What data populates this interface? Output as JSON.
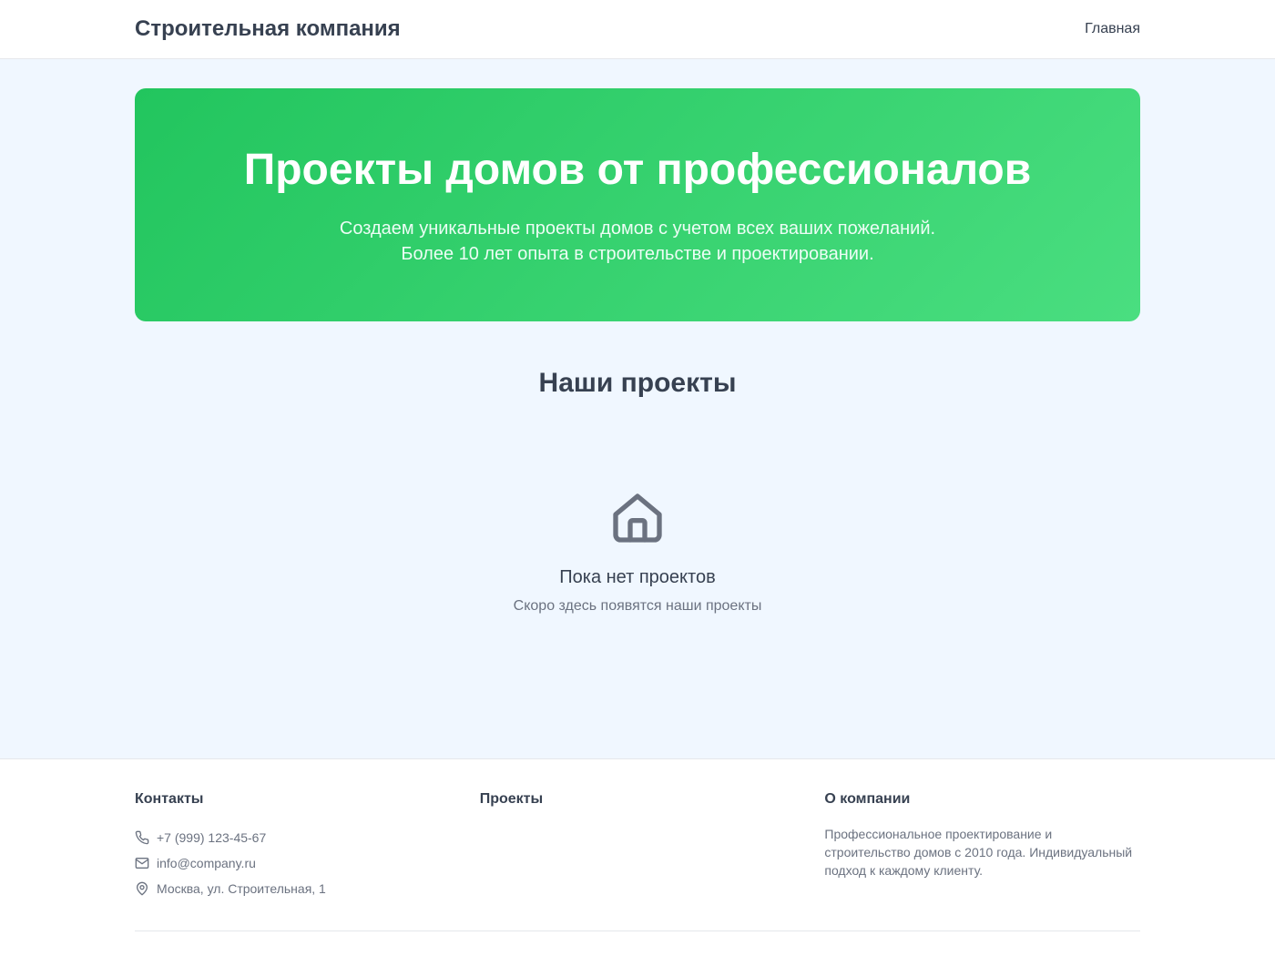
{
  "header": {
    "brand": "Строительная компания",
    "nav": [
      {
        "label": "Главная"
      }
    ]
  },
  "hero": {
    "title": "Проекты домов от профессионалов",
    "subtitle_line1": "Создаем уникальные проекты домов с учетом всех ваших пожеланий.",
    "subtitle_line2": "Более 10 лет опыта в строительстве и проектировании.",
    "gradient_start": "#22c55e",
    "gradient_end": "#4ade80"
  },
  "projects": {
    "heading": "Наши проекты",
    "empty_icon": "house-icon",
    "empty_title": "Пока нет проектов",
    "empty_subtitle": "Скоро здесь появятся наши проекты"
  },
  "footer": {
    "contacts": {
      "heading": "Контакты",
      "phone": "+7 (999) 123-45-67",
      "email": "info@company.ru",
      "address": "Москва, ул. Строительная, 1",
      "phone_icon": "phone-icon",
      "email_icon": "mail-icon",
      "address_icon": "map-pin-icon"
    },
    "projects": {
      "heading": "Проекты"
    },
    "about": {
      "heading": "О компании",
      "text": "Профессиональное проектирование и строительство домов с 2010 года. Индивидуальный подход к каждому клиенту."
    }
  }
}
